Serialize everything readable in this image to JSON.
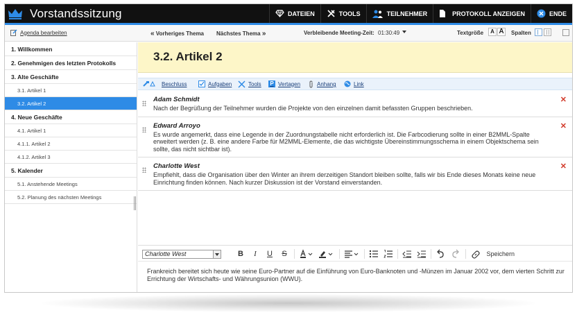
{
  "app": {
    "title": "Vorstandssitzung"
  },
  "topnav": [
    {
      "label": "DATEIEN",
      "icon": "diamond-icon"
    },
    {
      "label": "TOOLS",
      "icon": "tools-icon"
    },
    {
      "label": "TEILNEHMER",
      "icon": "users-icon"
    },
    {
      "label": "PROTOKOLL ANZEIGEN",
      "icon": "document-icon"
    },
    {
      "label": "ENDE",
      "icon": "close-circle-icon"
    }
  ],
  "toolbar": {
    "agenda_edit": "Agenda bearbeiten",
    "prev_topic": "Vorheriges Thema",
    "next_topic": "Nächstes Thema",
    "remaining_label": "Verbleibende Meeting-Zeit:",
    "remaining_value": "01:30:49",
    "textsize_label": "Textgröße",
    "textsize_small": "A",
    "textsize_large": "A",
    "columns_label": "Spalten"
  },
  "sidebar": {
    "items": [
      {
        "label": "1. Willkommen",
        "level": "heading",
        "active": false
      },
      {
        "label": "2. Genehmigen des letzten Protokolls",
        "level": "heading",
        "active": false
      },
      {
        "label": "3. Alte Geschäfte",
        "level": "heading",
        "active": false
      },
      {
        "label": "3.1. Artikel 1",
        "level": "sub",
        "active": false
      },
      {
        "label": "3.2. Artikel 2",
        "level": "sub",
        "active": true
      },
      {
        "label": "4. Neue Geschäfte",
        "level": "heading",
        "active": false
      },
      {
        "label": "4.1. Artikel 1",
        "level": "sub",
        "active": false
      },
      {
        "label": "4.1.1. Artikel 2",
        "level": "sub",
        "active": false
      },
      {
        "label": "4.1.2. Artikel 3",
        "level": "sub",
        "active": false
      },
      {
        "label": "5. Kalender",
        "level": "heading",
        "active": false
      },
      {
        "label": "5.1. Anstehende Meetings",
        "level": "sub",
        "active": false
      },
      {
        "label": "5.2. Planung des nächsten Meetings",
        "level": "sub",
        "active": false
      }
    ]
  },
  "main": {
    "title": "3.2. Artikel 2",
    "actions": [
      {
        "label": "Beschluss",
        "icon": "gavel-icon"
      },
      {
        "label": "Aufgaben",
        "icon": "checkbox-icon"
      },
      {
        "label": "Tools",
        "icon": "tools-icon"
      },
      {
        "label": "Vertagen",
        "icon": "postpone-icon"
      },
      {
        "label": "Anhang",
        "icon": "paperclip-icon"
      },
      {
        "label": "Link",
        "icon": "globe-icon"
      }
    ],
    "notes": [
      {
        "author": "Adam Schmidt",
        "text": "Nach der Begrüßung der Teilnehmer wurden die Projekte von den einzelnen damit befassten Gruppen beschrieben."
      },
      {
        "author": "Edward Arroyo",
        "text": "Es wurde angemerkt, dass eine Legende in der Zuordnungstabelle nicht erforderlich ist. Die Farbcodierung sollte in einer B2MML-Spalte erweitert werden (z. B. eine andere Farbe für M2MML-Elemente, die das wichtigste Übereinstimmungsschema in einem Objektschema sein sollte, das nicht sichtbar ist)."
      },
      {
        "author": "Charlotte West",
        "text": "Empfiehlt, dass die Organisation über den Winter an ihrem derzeitigen Standort bleiben sollte, falls wir bis Ende dieses Monats keine neue Einrichtung finden können. Nach kurzer Diskussion ist der Vorstand einverstanden."
      }
    ]
  },
  "editor": {
    "speaker": "Charlotte West",
    "save_label": "Speichern",
    "text": "Frankreich bereitet sich heute wie seine Euro-Partner auf die Einführung von Euro-Banknoten und -Münzen im Januar 2002 vor, dem vierten Schritt zur Errichtung der Wirtschafts- und Währungsunion (WWU)."
  },
  "colors": {
    "accent": "#2e8be6",
    "topbar": "#111111",
    "title_bg": "#fdf6c8",
    "delete": "#d23a2a"
  }
}
